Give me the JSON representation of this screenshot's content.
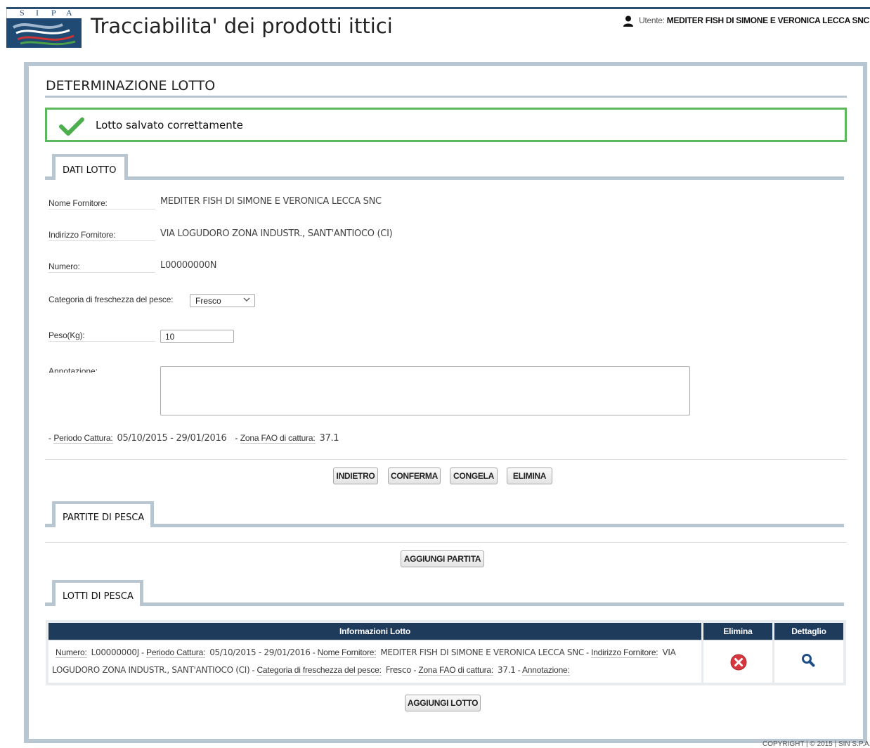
{
  "header": {
    "logo_letters": [
      "S",
      "I",
      "P",
      "A"
    ],
    "app_title": "Tracciabilita' dei prodotti ittici",
    "user_label": "Utente:",
    "user_name": "MEDITER FISH DI SIMONE E VERONICA LECCA SNC"
  },
  "page_title": "DETERMINAZIONE LOTTO",
  "success_message": "Lotto salvato correttamente",
  "sections": {
    "dati_lotto": "DATI LOTTO",
    "partite_di_pesca": "PARTITE DI PESCA",
    "lotti_di_pesca": "LOTTI DI PESCA"
  },
  "form": {
    "nome_fornitore": {
      "label": "Nome Fornitore:",
      "value": "MEDITER FISH DI SIMONE E VERONICA LECCA SNC"
    },
    "indirizzo_fornitore": {
      "label": "Indirizzo Fornitore:",
      "value": "VIA LOGUDORO ZONA INDUSTR., SANT'ANTIOCO (CI)"
    },
    "numero": {
      "label": "Numero:",
      "value": "L00000000N"
    },
    "categoria": {
      "label": "Categoria di freschezza del pesce:",
      "value": "Fresco"
    },
    "peso": {
      "label": "Peso(Kg):",
      "value": "10"
    },
    "annotazione": {
      "label": "Annotazione:",
      "value": ""
    },
    "periodo_cattura": {
      "label": "Periodo Cattura:",
      "value": "05/10/2015 - 29/01/2016"
    },
    "zona_fao": {
      "label": "Zona FAO di cattura:",
      "value": "37.1"
    }
  },
  "buttons": {
    "indietro": "INDIETRO",
    "conferma": "CONFERMA",
    "congela": "CONGELA",
    "elimina": "ELIMINA",
    "aggiungi_partita": "AGGIUNGI PARTITA",
    "aggiungi_lotto": "AGGIUNGI LOTTO"
  },
  "lotti_table": {
    "headers": {
      "info": "Informazioni Lotto",
      "elimina": "Elimina",
      "dettaglio": "Dettaglio"
    },
    "row": {
      "numero": {
        "label": "Numero:",
        "value": "L00000000J"
      },
      "periodo_cattura": {
        "label": "Periodo Cattura:",
        "value": "05/10/2015 - 29/01/2016"
      },
      "nome_fornitore": {
        "label": "Nome Fornitore:",
        "value": "MEDITER FISH DI SIMONE E VERONICA LECCA SNC"
      },
      "indirizzo_fornitore": {
        "label": "Indirizzo Fornitore:",
        "value": "VIA LOGUDORO ZONA INDUSTR., SANT'ANTIOCO (CI)"
      },
      "categoria": {
        "label": "Categoria di freschezza del pesce:",
        "value": "Fresco"
      },
      "zona_fao": {
        "label": "Zona FAO di cattura:",
        "value": "37.1"
      },
      "annotazione": {
        "label": "Annotazione:",
        "value": ""
      }
    }
  },
  "footer": "COPYRIGHT | © 2015 | SIN S.P.A.",
  "colors": {
    "primary_dark": "#1f3b5c",
    "panel_border": "#b8c6d1",
    "success_green": "#5cb85c",
    "delete_red": "#d9373f",
    "detail_blue": "#1f4e86"
  }
}
